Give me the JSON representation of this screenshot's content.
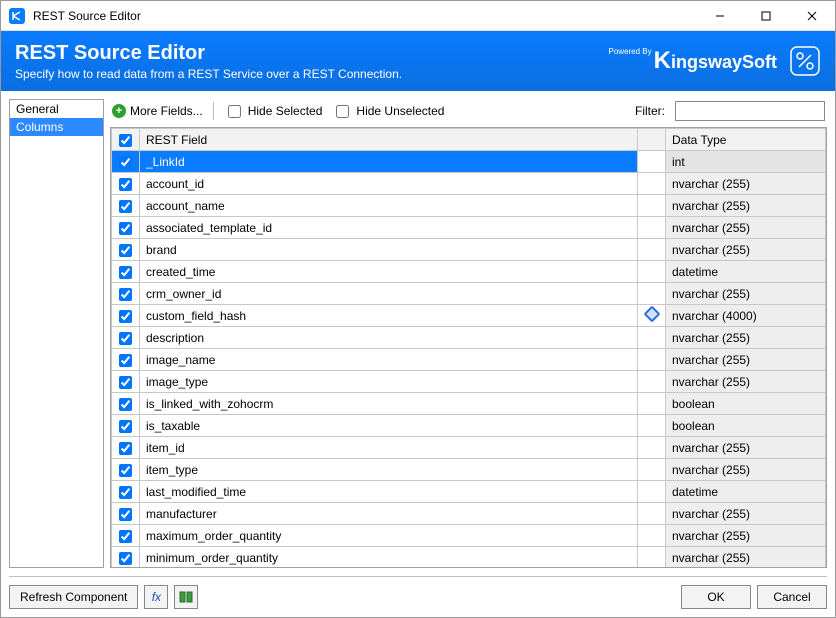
{
  "window": {
    "title": "REST Source Editor"
  },
  "header": {
    "title": "REST Source Editor",
    "subtitle": "Specify how to read data from a REST Service over a REST Connection.",
    "brand_powered": "Powered By",
    "brand_name": "ingswaySoft"
  },
  "sidebar": {
    "items": [
      "General",
      "Columns"
    ],
    "selected_index": 1
  },
  "toolbar": {
    "more_fields": "More Fields...",
    "hide_selected": "Hide Selected",
    "hide_unselected": "Hide Unselected",
    "filter_label": "Filter:",
    "filter_value": ""
  },
  "grid": {
    "headers": {
      "field": "REST Field",
      "type": "Data Type"
    },
    "selected_index": 0,
    "rows": [
      {
        "checked": true,
        "field": "_LinkId",
        "type": "int",
        "icon": false
      },
      {
        "checked": true,
        "field": "account_id",
        "type": "nvarchar (255)",
        "icon": false
      },
      {
        "checked": true,
        "field": "account_name",
        "type": "nvarchar (255)",
        "icon": false
      },
      {
        "checked": true,
        "field": "associated_template_id",
        "type": "nvarchar (255)",
        "icon": false
      },
      {
        "checked": true,
        "field": "brand",
        "type": "nvarchar (255)",
        "icon": false
      },
      {
        "checked": true,
        "field": "created_time",
        "type": "datetime",
        "icon": false
      },
      {
        "checked": true,
        "field": "crm_owner_id",
        "type": "nvarchar (255)",
        "icon": false
      },
      {
        "checked": true,
        "field": "custom_field_hash",
        "type": "nvarchar (4000)",
        "icon": true
      },
      {
        "checked": true,
        "field": "description",
        "type": "nvarchar (255)",
        "icon": false
      },
      {
        "checked": true,
        "field": "image_name",
        "type": "nvarchar (255)",
        "icon": false
      },
      {
        "checked": true,
        "field": "image_type",
        "type": "nvarchar (255)",
        "icon": false
      },
      {
        "checked": true,
        "field": "is_linked_with_zohocrm",
        "type": "boolean",
        "icon": false
      },
      {
        "checked": true,
        "field": "is_taxable",
        "type": "boolean",
        "icon": false
      },
      {
        "checked": true,
        "field": "item_id",
        "type": "nvarchar (255)",
        "icon": false
      },
      {
        "checked": true,
        "field": "item_type",
        "type": "nvarchar (255)",
        "icon": false
      },
      {
        "checked": true,
        "field": "last_modified_time",
        "type": "datetime",
        "icon": false
      },
      {
        "checked": true,
        "field": "manufacturer",
        "type": "nvarchar (255)",
        "icon": false
      },
      {
        "checked": true,
        "field": "maximum_order_quantity",
        "type": "nvarchar (255)",
        "icon": false
      },
      {
        "checked": true,
        "field": "minimum_order_quantity",
        "type": "nvarchar (255)",
        "icon": false
      }
    ]
  },
  "bottom": {
    "refresh": "Refresh Component",
    "ok": "OK",
    "cancel": "Cancel"
  }
}
